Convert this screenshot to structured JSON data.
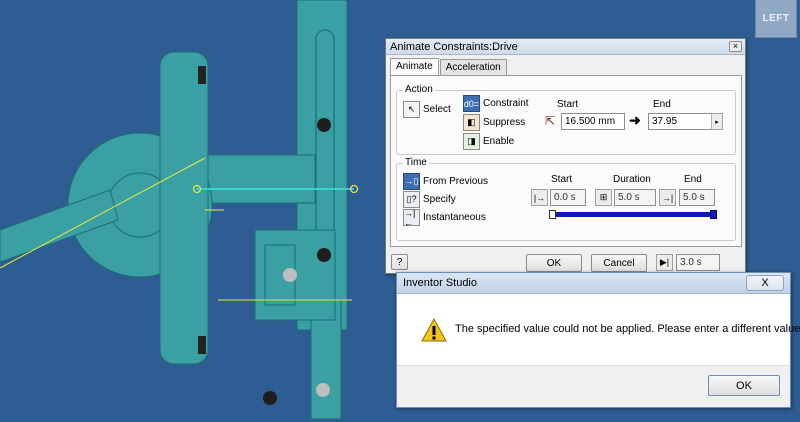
{
  "viewport": {
    "viewcube_label": "LEFT",
    "colors": {
      "background": "#2e5d93",
      "part": "#3aa0a4",
      "part_edge": "#1f6e72",
      "sketch_line": "#e6ea3a",
      "constraint_line": "#40e0e0"
    }
  },
  "animate_dialog": {
    "title": "Animate Constraints:Drive",
    "close_glyph": "×",
    "tabs": [
      {
        "label": "Animate",
        "active": true
      },
      {
        "label": "Acceleration",
        "active": false
      }
    ],
    "action": {
      "group_title": "Action",
      "select_label": "Select",
      "options": [
        {
          "label": "Constraint",
          "icon": "constraint-icon",
          "active": true
        },
        {
          "label": "Suppress",
          "icon": "suppress-icon",
          "active": false
        },
        {
          "label": "Enable",
          "icon": "enable-icon",
          "active": false
        }
      ],
      "start_label": "Start",
      "end_label": "End",
      "start_value": "16.500 mm",
      "end_value": "37.95",
      "arrow_glyph": "➜"
    },
    "time": {
      "group_title": "Time",
      "options": [
        {
          "label": "From Previous",
          "icon": "from-previous-icon"
        },
        {
          "label": "Specify",
          "icon": "specify-icon"
        },
        {
          "label": "Instantaneous",
          "icon": "instantaneous-icon"
        }
      ],
      "start_label": "Start",
      "duration_label": "Duration",
      "end_label": "End",
      "start_value": "0.0 s",
      "duration_value": "5.0 s",
      "end_value": "5.0 s",
      "slider_fill_fraction": 1.0
    },
    "footer": {
      "help_glyph": "?",
      "ok_label": "OK",
      "cancel_label": "Cancel",
      "current_time": "3.0 s"
    }
  },
  "studio_dialog": {
    "title": "Inventor Studio",
    "close_glyph": "X",
    "message": "The specified value could not be applied. Please enter a different value.",
    "ok_label": "OK"
  }
}
